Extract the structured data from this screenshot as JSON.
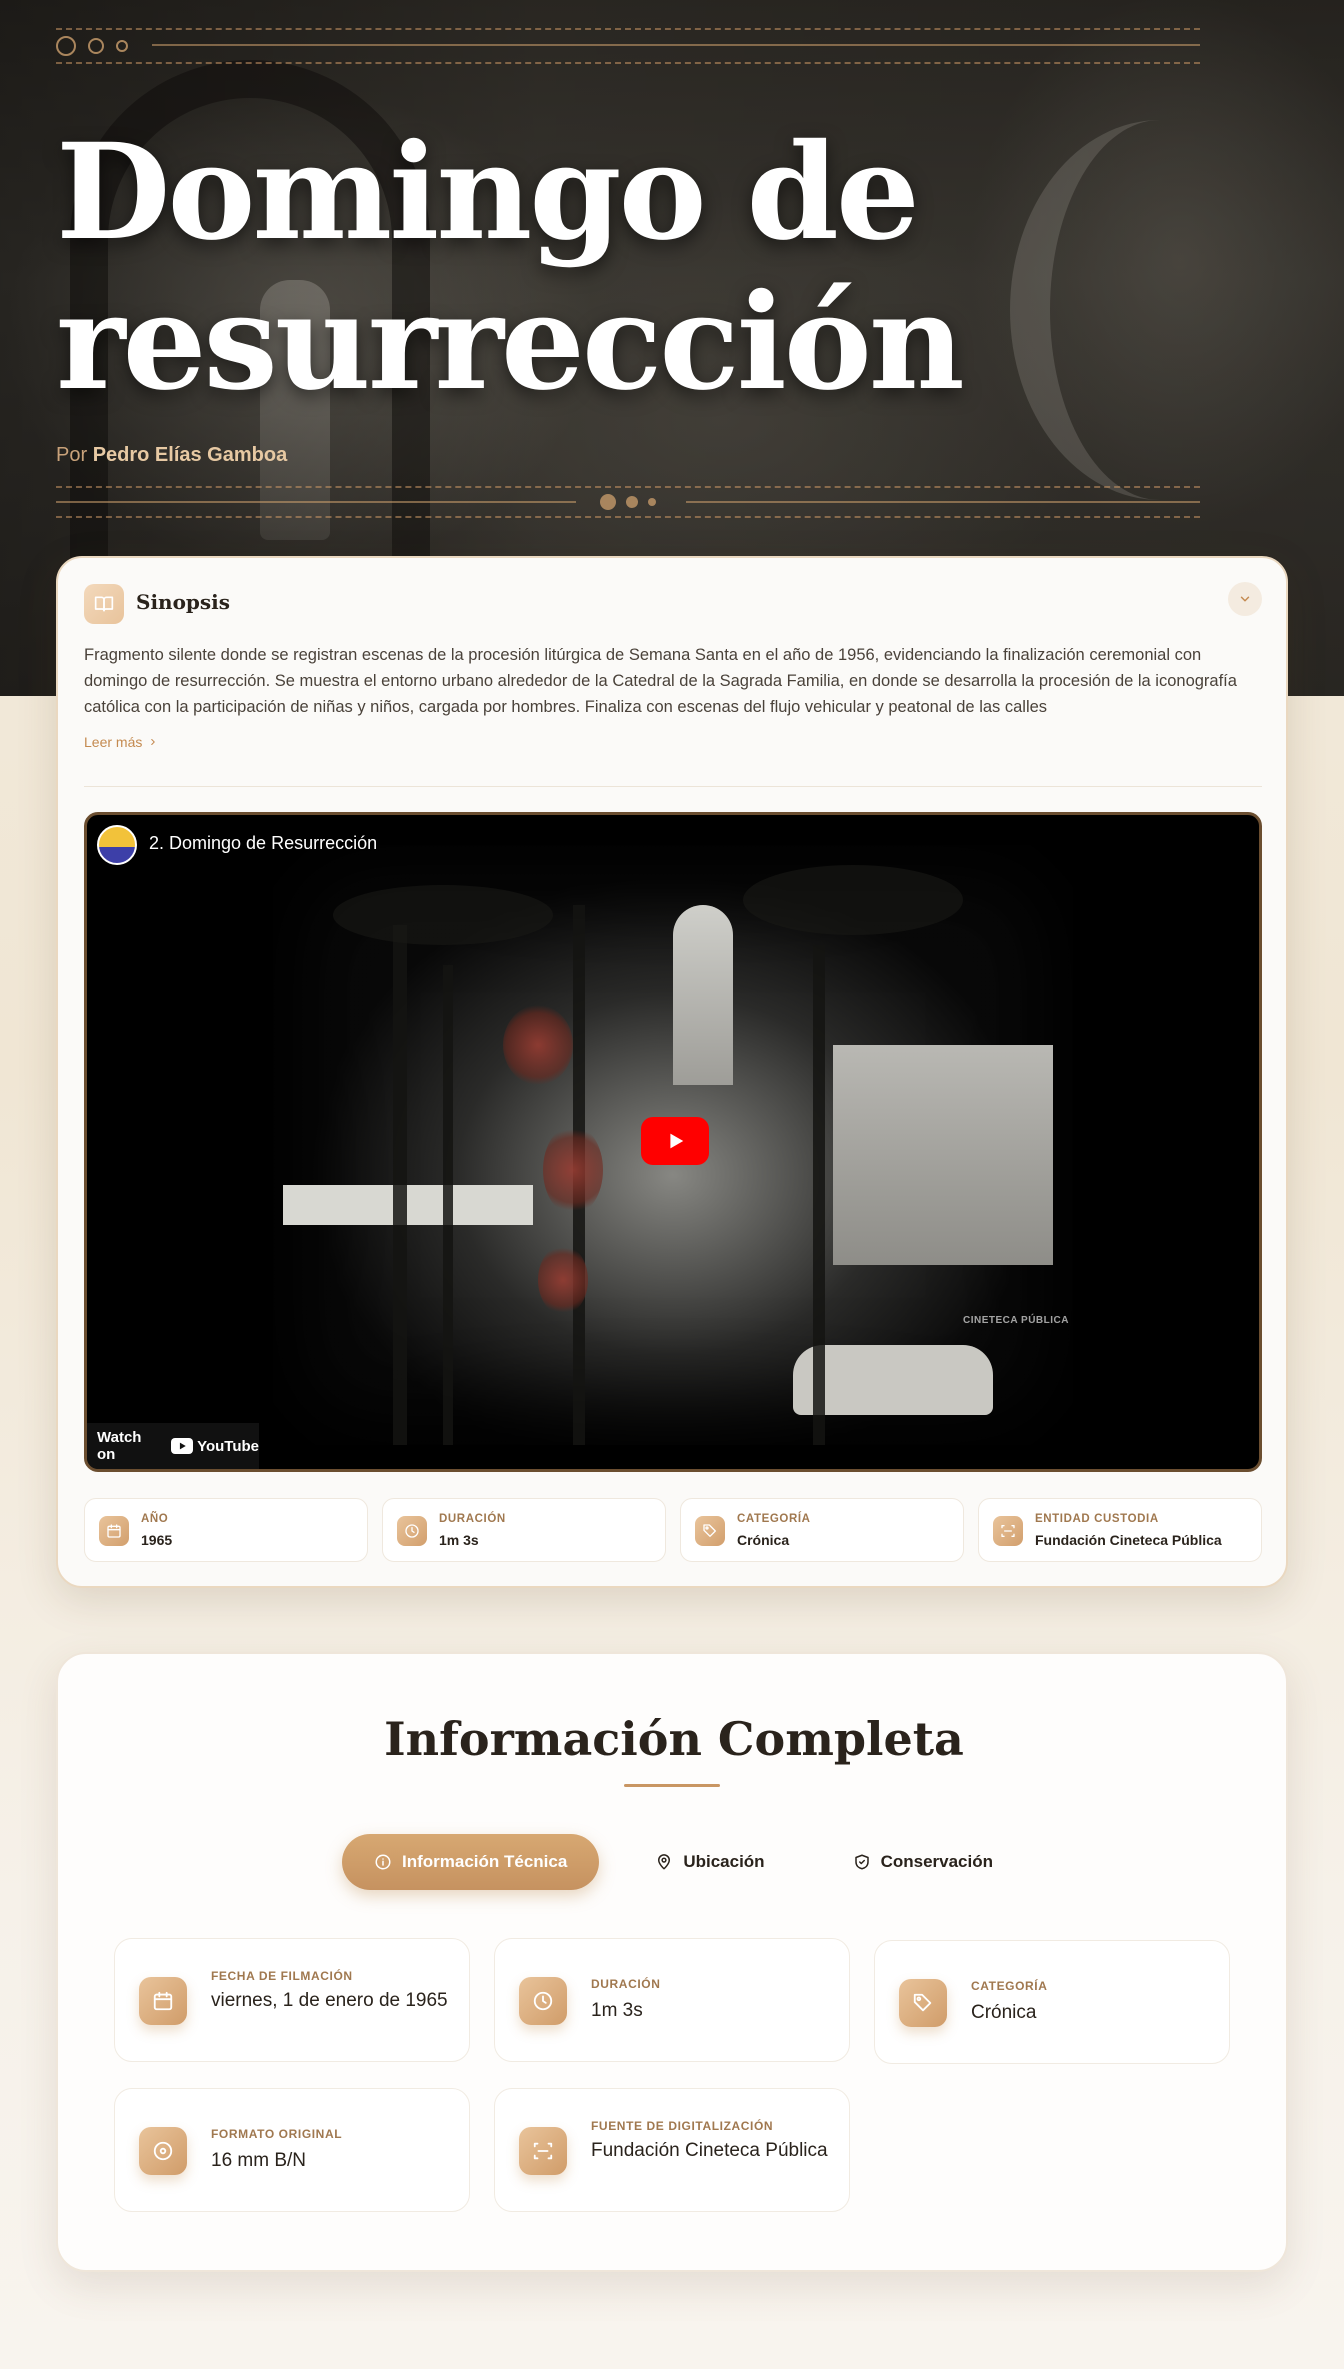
{
  "hero": {
    "title_line1": "Domingo de",
    "title_line2": "resurrección",
    "author_prefix": "Por",
    "author_name": "Pedro Elías Gamboa"
  },
  "synopsis": {
    "title": "Sinopsis",
    "text": "Fragmento silente donde se registran escenas de la procesión litúrgica de Semana Santa en el año de 1956, evidenciando la finalización ceremonial con domingo de resurrección. Se muestra el entorno urbano alrededor de la Catedral de la Sagrada Familia, en donde se desarrolla la procesión de la iconografía católica con la participación de niñas y niños, cargada por hombres. Finaliza con escenas del flujo vehicular y peatonal de las calles",
    "read_more": "Leer más"
  },
  "video": {
    "title": "2. Domingo de Resurrección",
    "watch_on": "Watch on",
    "platform": "YouTube",
    "watermark": "CINETECA PÚBLICA"
  },
  "meta": [
    {
      "label": "AÑO",
      "value": "1965",
      "icon": "calendar-icon"
    },
    {
      "label": "DURACIÓN",
      "value": "1m 3s",
      "icon": "clock-icon"
    },
    {
      "label": "CATEGORÍA",
      "value": "Crónica",
      "icon": "tag-icon"
    },
    {
      "label": "ENTIDAD CUSTODIA",
      "value": "Fundación Cineteca Pública",
      "icon": "scan-icon"
    }
  ],
  "info": {
    "title": "Información Completa",
    "tabs": [
      {
        "label": "Información Técnica",
        "icon": "info-icon",
        "active": true
      },
      {
        "label": "Ubicación",
        "icon": "map-pin-icon",
        "active": false
      },
      {
        "label": "Conservación",
        "icon": "shield-check-icon",
        "active": false
      }
    ],
    "items": [
      {
        "label": "FECHA DE FILMACIÓN",
        "value": "viernes, 1 de enero de 1965",
        "icon": "calendar-icon"
      },
      {
        "label": "DURACIÓN",
        "value": "1m 3s",
        "icon": "clock-icon"
      },
      {
        "label": "CATEGORÍA",
        "value": "Crónica",
        "icon": "tag-icon"
      },
      {
        "label": "FORMATO ORIGINAL",
        "value": "16 mm B/N",
        "icon": "disc-icon"
      },
      {
        "label": "FUENTE DE DIGITALIZACIÓN",
        "value": "Fundación Cineteca Pública",
        "icon": "scan-icon"
      }
    ]
  },
  "colors": {
    "accent": "#c99663",
    "accent_dark": "#a0784f",
    "youtube_red": "#ff0000"
  }
}
